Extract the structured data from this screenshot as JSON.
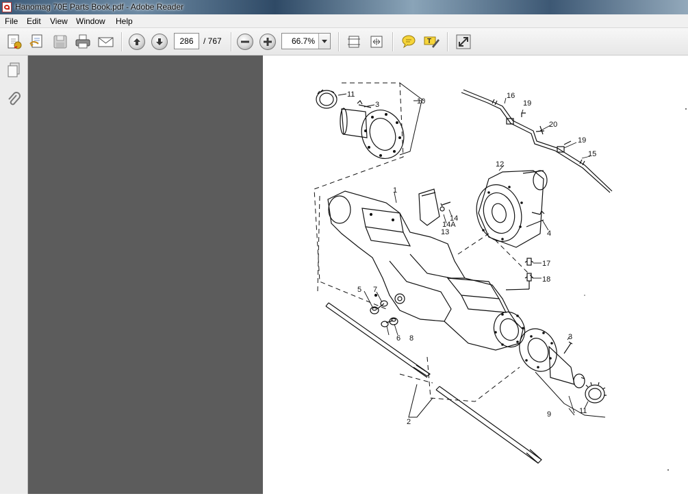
{
  "window": {
    "title": "Hanomag 70E Parts Book.pdf - Adobe Reader"
  },
  "menu": [
    "File",
    "Edit",
    "View",
    "Window",
    "Help"
  ],
  "toolbar": {
    "page_current": "286",
    "page_total": "/ 767",
    "zoom": "66.7%"
  },
  "diagram": {
    "callouts": [
      "1",
      "2",
      "3",
      "3",
      "4",
      "5",
      "6",
      "7",
      "8",
      "9",
      "10",
      "11",
      "11",
      "12",
      "13",
      "14",
      "14A",
      "15",
      "16",
      "17",
      "18",
      "19",
      "19",
      "20"
    ]
  },
  "colors": {
    "doc_bg": "#5c5c5c",
    "nav_bg": "#ececec",
    "page_bg": "#ffffff"
  },
  "icons": [
    "pdf-app-icon",
    "create-pdf-icon",
    "edit-icon",
    "save-icon",
    "print-icon",
    "email-icon",
    "previous-page-icon",
    "next-page-icon",
    "zoom-out-icon",
    "zoom-in-icon",
    "fit-page-icon",
    "fit-width-icon",
    "comment-icon",
    "highlight-icon",
    "fullscreen-icon",
    "pages-panel-icon",
    "attachments-panel-icon"
  ]
}
